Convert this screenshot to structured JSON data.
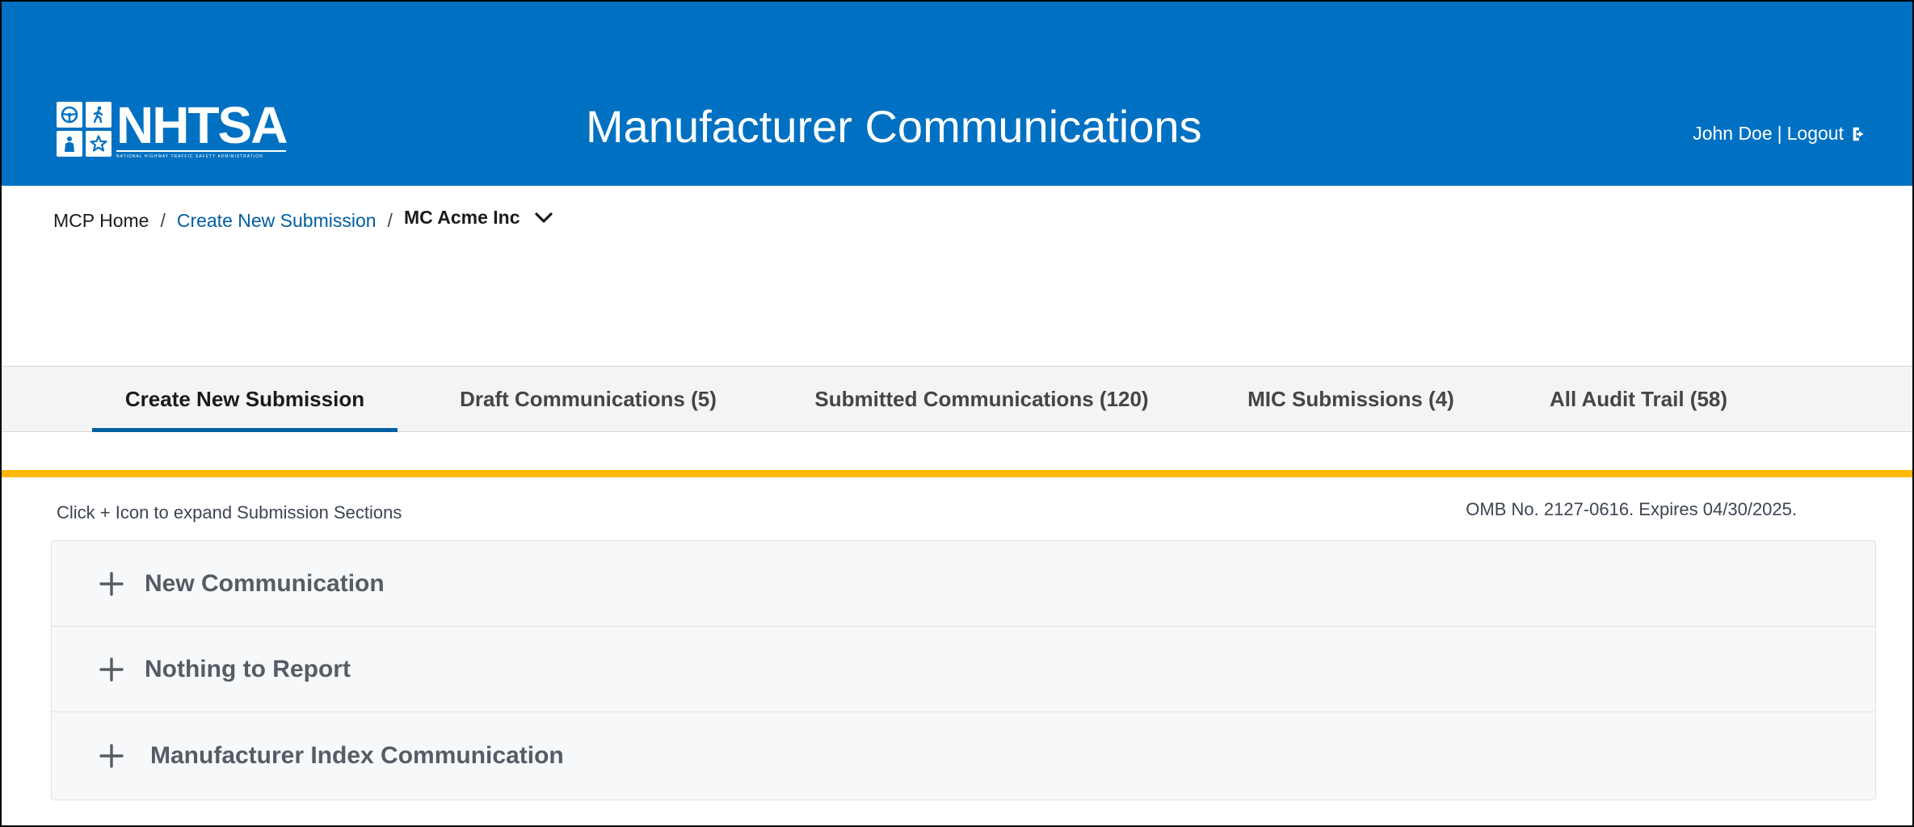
{
  "colors": {
    "header_bg": "#0071c2",
    "accent_gold": "#ffb700",
    "link": "#005ea2",
    "tab_bar_bg": "#f3f4f6"
  },
  "header": {
    "logo_text": "NHTSA",
    "logo_subtext": "NATIONAL HIGHWAY TRAFFIC SAFETY ADMINISTRATION",
    "logo_icons": [
      "steering-wheel-icon",
      "pedestrian-icon",
      "car-seat-icon",
      "star-icon"
    ],
    "title": "Manufacturer Communications",
    "user_name": "John Doe",
    "separator": "|",
    "logout_label": "Logout",
    "logout_icon": "logout-icon"
  },
  "breadcrumb": {
    "home": "MCP Home",
    "separator": "/",
    "link": "Create New Submission",
    "current": "MC Acme Inc",
    "current_icon": "chevron-down-icon"
  },
  "tabs": [
    {
      "label": "Create New Submission",
      "active": true
    },
    {
      "label": "Draft Communications (5)",
      "active": false
    },
    {
      "label": "Submitted Communications (120)",
      "active": false
    },
    {
      "label": "MIC Submissions (4)",
      "active": false
    },
    {
      "label": "All Audit Trail (58)",
      "active": false
    }
  ],
  "content": {
    "hint": "Click + Icon to expand Submission Sections",
    "omb_notice": "OMB No. 2127-0616. Expires 04/30/2025.",
    "sections": [
      {
        "label": "New Communication",
        "icon": "plus-icon"
      },
      {
        "label": "Nothing to Report",
        "icon": "plus-icon"
      },
      {
        "label": "Manufacturer Index Communication",
        "icon": "plus-icon"
      }
    ]
  }
}
